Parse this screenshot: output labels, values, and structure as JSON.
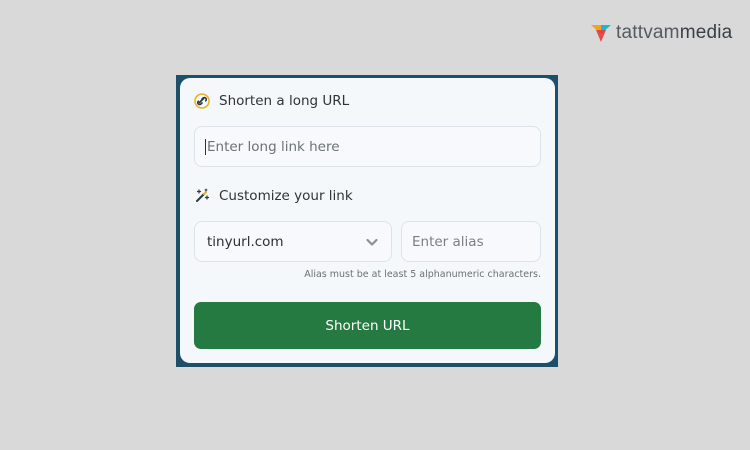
{
  "brand": {
    "logo_part1": "tattvam",
    "logo_part2": "media",
    "colors": [
      "#f6a21b",
      "#e23b3b",
      "#1fb6d6"
    ]
  },
  "form": {
    "long_url": {
      "heading": "Shorten a long URL",
      "heading_icon": "link-icon",
      "placeholder": "Enter long link here",
      "value": ""
    },
    "customize": {
      "heading": "Customize your link",
      "heading_icon": "magic-wand-icon",
      "domain_selected": "tinyurl.com",
      "alias_placeholder": "Enter alias",
      "alias_hint": "Alias must be at least 5 alphanumeric characters."
    },
    "submit_label": "Shorten URL",
    "accent_color": "#247a40",
    "frame_color": "#1d4f6a"
  }
}
